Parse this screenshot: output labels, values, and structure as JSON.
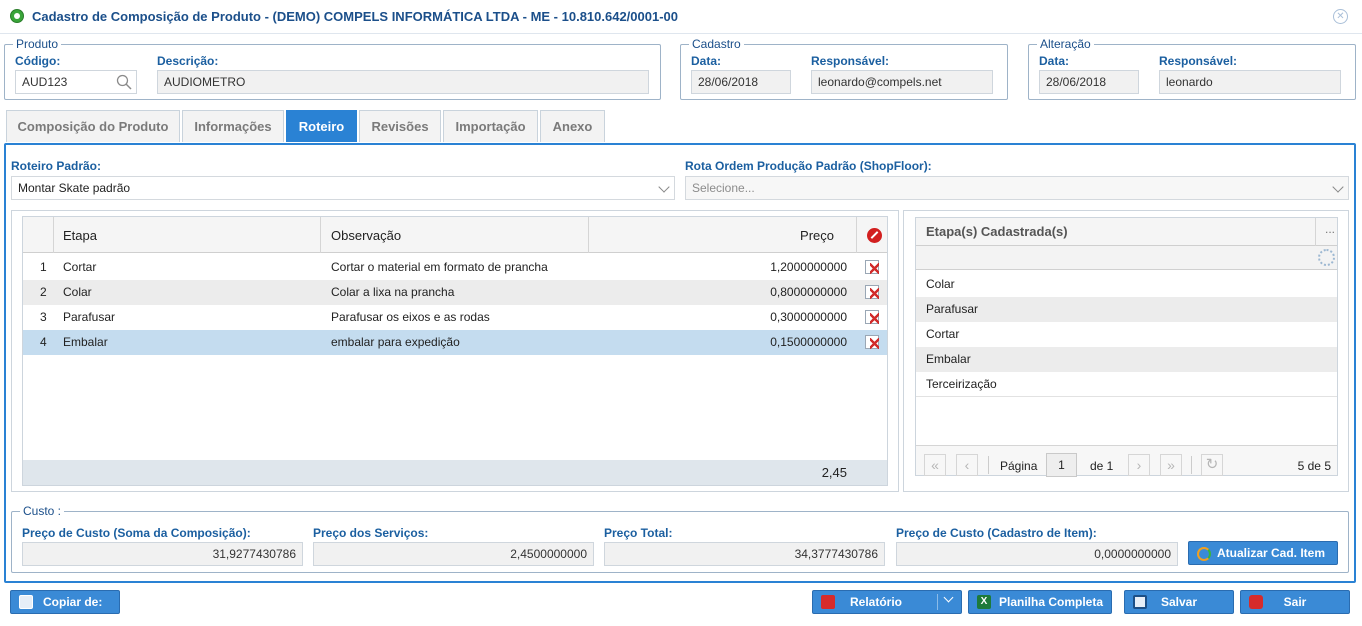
{
  "window": {
    "title": "Cadastro de Composição de Produto - (DEMO) COMPELS INFORMÁTICA LTDA - ME - 10.810.642/0001-00"
  },
  "produto": {
    "legend": "Produto",
    "codigo_label": "Código:",
    "codigo_value": "AUD123",
    "descricao_label": "Descrição:",
    "descricao_value": "AUDIOMETRO"
  },
  "cadastro": {
    "legend": "Cadastro",
    "data_label": "Data:",
    "data_value": "28/06/2018",
    "resp_label": "Responsável:",
    "resp_value": "leonardo@compels.net"
  },
  "alteracao": {
    "legend": "Alteração",
    "data_label": "Data:",
    "data_value": "28/06/2018",
    "resp_label": "Responsável:",
    "resp_value": "leonardo"
  },
  "tabs": [
    "Composição do Produto",
    "Informações",
    "Roteiro",
    "Revisões",
    "Importação",
    "Anexo"
  ],
  "active_tab": "Roteiro",
  "roteiro": {
    "label": "Roteiro Padrão:",
    "value": "Montar Skate padrão"
  },
  "rota": {
    "label": "Rota Ordem Produção Padrão (ShopFloor):",
    "placeholder": "Selecione..."
  },
  "grid": {
    "headers": {
      "etapa": "Etapa",
      "obs": "Observação",
      "preco": "Preço"
    },
    "rows": [
      {
        "n": "1",
        "etapa": "Cortar",
        "obs": "Cortar o material em formato de prancha",
        "preco": "1,2000000000"
      },
      {
        "n": "2",
        "etapa": "Colar",
        "obs": "Colar a lixa na prancha",
        "preco": "0,8000000000"
      },
      {
        "n": "3",
        "etapa": "Parafusar",
        "obs": "Parafusar os eixos e as rodas",
        "preco": "0,3000000000"
      },
      {
        "n": "4",
        "etapa": "Embalar",
        "obs": "embalar para expedição",
        "preco": "0,1500000000"
      }
    ],
    "total": "2,45"
  },
  "etapas": {
    "header": "Etapa(s) Cadastrada(s)",
    "menu": "...",
    "items": [
      "Colar",
      "Parafusar",
      "Cortar",
      "Embalar",
      "Terceirização"
    ],
    "pager": {
      "page_label": "Página",
      "page": "1",
      "of": "de 1",
      "count": "5 de 5"
    }
  },
  "custo": {
    "legend": "Custo :",
    "pc_label": "Preço de Custo (Soma da Composição):",
    "pc_value": "31,9277430786",
    "ps_label": "Preço dos Serviços:",
    "ps_value": "2,4500000000",
    "pt_label": "Preço Total:",
    "pt_value": "34,3777430786",
    "pci_label": "Preço de Custo (Cadastro de Item):",
    "pci_value": "0,0000000000",
    "atualizar": "Atualizar Cad. Item"
  },
  "footer": {
    "copiar": "Copiar de:",
    "relatorio": "Relatório",
    "planilha": "Planilha Completa",
    "salvar": "Salvar",
    "sair": "Sair"
  },
  "colors": {
    "accent": "#2a82d4",
    "label": "#1b5fa0",
    "selected_row": "#c4dcef"
  }
}
